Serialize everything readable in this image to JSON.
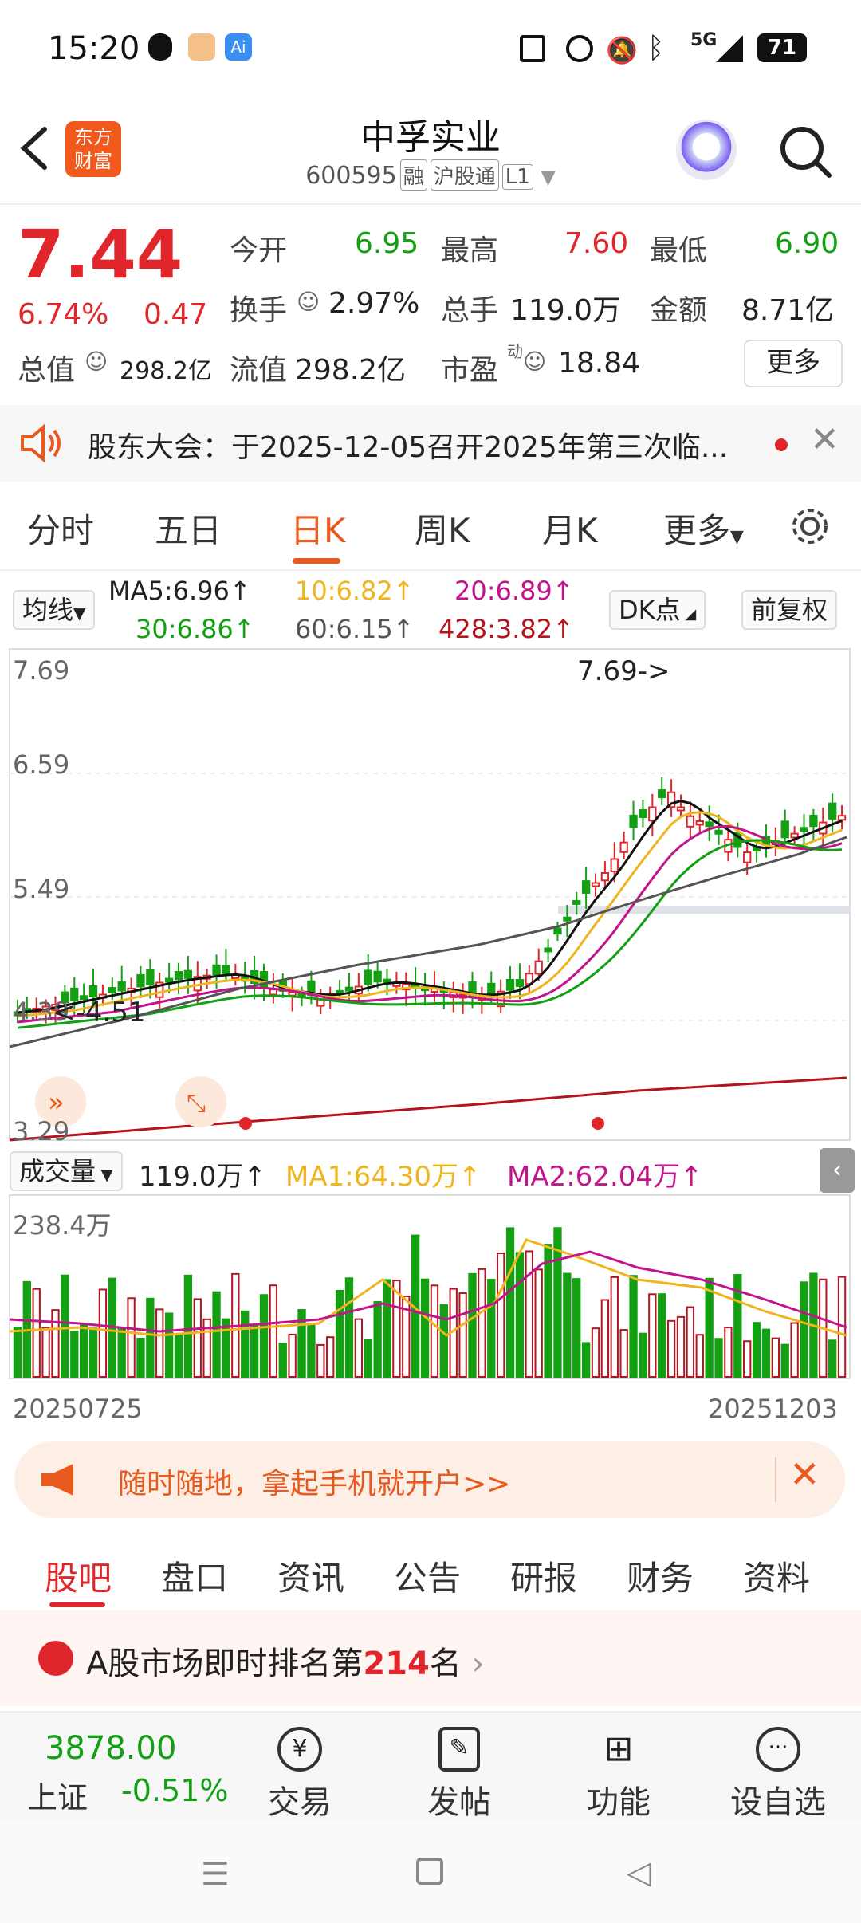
{
  "status_bar": {
    "time": "15:20",
    "battery": "71",
    "network": "5G"
  },
  "header": {
    "logo_line1": "东方",
    "logo_line2": "财富",
    "title": "中孚实业",
    "code": "600595",
    "tags": [
      "融",
      "沪股通",
      "L1"
    ]
  },
  "quote": {
    "price": "7.44",
    "change_pct": "6.74%",
    "change": "0.47",
    "open_label": "今开",
    "open": "6.95",
    "high_label": "最高",
    "high": "7.60",
    "low_label": "最低",
    "low": "6.90",
    "turnover_label": "换手",
    "turnover": "2.97%",
    "volume_label": "总手",
    "volume": "119.0万",
    "amount_label": "金额",
    "amount": "8.71亿",
    "mktcap_label": "总值",
    "mktcap": "298.2亿",
    "float_label": "流值",
    "float": "298.2亿",
    "pe_label": "市盈",
    "pe_sup": "动",
    "pe": "18.84",
    "more_button": "更多"
  },
  "notice": {
    "text": "股东大会：于2025-12-05召开2025年第三次临..."
  },
  "chart_tabs": [
    "分时",
    "五日",
    "日K",
    "周K",
    "月K",
    "更多"
  ],
  "active_chart_tab": "日K",
  "ma": {
    "selector": "均线",
    "ma5": "MA5:6.96↑",
    "ma10": "10:6.82↑",
    "ma20": "20:6.89↑",
    "ma30": "30:6.86↑",
    "ma60": "60:6.15↑",
    "ma428": "428:3.82↑",
    "dk_button": "DK点",
    "adjust_button": "前复权"
  },
  "kline": {
    "y_labels": [
      "7.69",
      "6.59",
      "5.49",
      "4.39",
      "3.29"
    ],
    "high_marker": "7.69->",
    "low_marker": "<-4.51"
  },
  "volume": {
    "label": "成交量",
    "value": "119.0万↑",
    "ma1": "MA1:64.30万↑",
    "ma2": "MA2:62.04万↑",
    "max": "238.4万",
    "start_date": "20250725",
    "end_date": "20251203"
  },
  "banner": {
    "text": "随时随地，拿起手机就开户>>"
  },
  "bottom_tabs": [
    "股吧",
    "盘口",
    "资讯",
    "公告",
    "研报",
    "财务",
    "资料"
  ],
  "rank": {
    "prefix": "A股市场即时排名第",
    "number": "214",
    "suffix": "名"
  },
  "toolbar": {
    "index_value": "3878.00",
    "index_name": "上证",
    "index_change": "-0.51%",
    "items": [
      "交易",
      "发帖",
      "功能",
      "设自选"
    ]
  },
  "colors": {
    "up": "#e0262b",
    "down": "#13a013",
    "accent": "#e85a1d"
  }
}
